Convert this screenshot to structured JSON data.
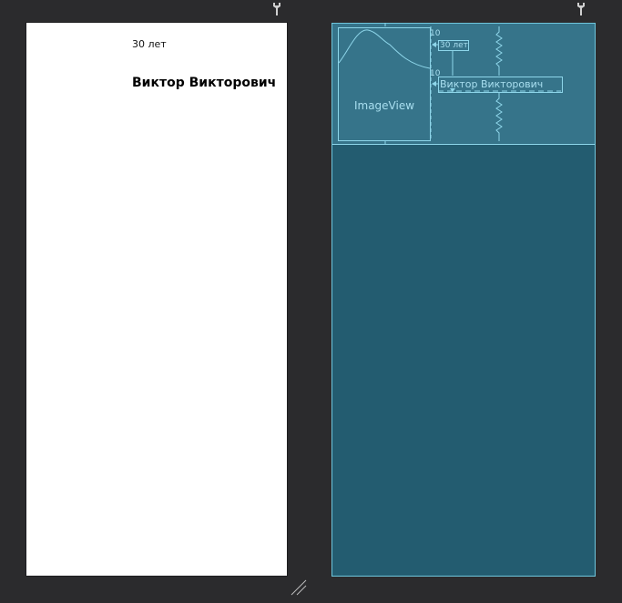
{
  "design": {
    "age_text": "30 лет",
    "name_text": "Виктор Викторович"
  },
  "blueprint": {
    "imageview_label": "ImageView",
    "age_text": "30 лет",
    "name_text": "Виктор Викторович",
    "margin_top_label": "10",
    "margin_between_label": "10"
  },
  "icons": {
    "design_tool": "wrench-icon",
    "blueprint_tool": "wrench-icon",
    "resize": "resize-handle-icon"
  },
  "colors": {
    "canvas_bg": "#2b2b2d",
    "blueprint_bg": "#235c70",
    "blueprint_line": "#8ed6ea"
  }
}
